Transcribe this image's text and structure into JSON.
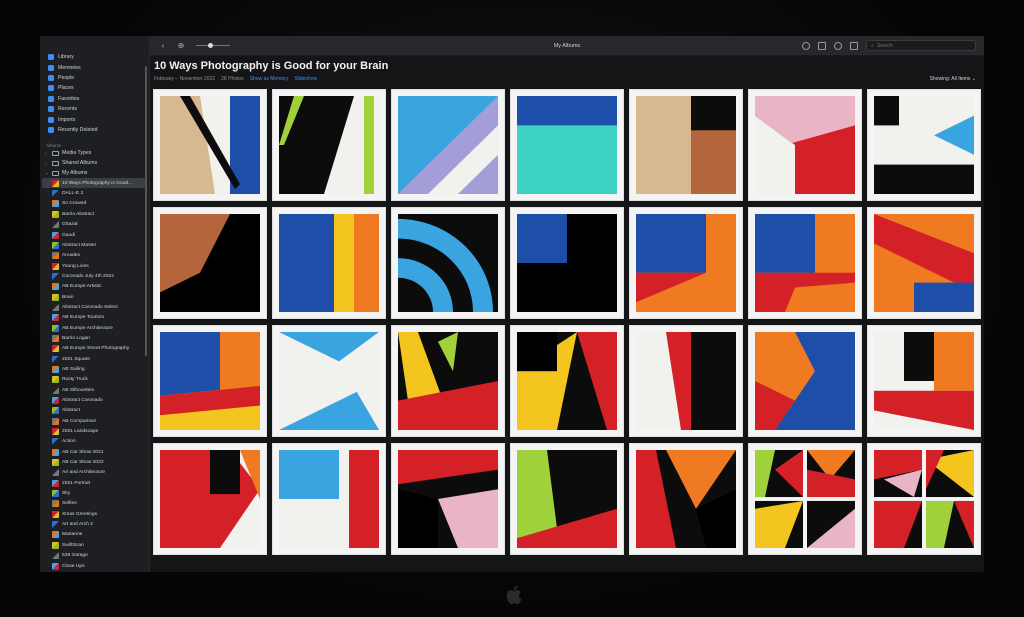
{
  "toolbar": {
    "window_title": "My Albums",
    "back_label": "‹",
    "search_placeholder": "Search"
  },
  "sidebar": {
    "library_items": [
      {
        "label": "Library",
        "icon": "photo-library-icon"
      },
      {
        "label": "Memories",
        "icon": "memories-icon"
      },
      {
        "label": "People",
        "icon": "people-icon"
      },
      {
        "label": "Places",
        "icon": "places-icon"
      },
      {
        "label": "Favorites",
        "icon": "heart-icon"
      },
      {
        "label": "Recents",
        "icon": "clock-icon"
      },
      {
        "label": "Imports",
        "icon": "import-icon"
      },
      {
        "label": "Recently Deleted",
        "icon": "trash-icon"
      }
    ],
    "albums_section": "Albums",
    "folders": [
      {
        "label": "Media Types",
        "chevron": "›"
      },
      {
        "label": "Shared Albums",
        "chevron": "›"
      },
      {
        "label": "My Albums",
        "chevron": "⌄"
      }
    ],
    "albums": [
      "10 Ways Photography is Good...",
      "DALL-E 2",
      "So Crowed",
      "Barrio Abstract",
      "Ghazal",
      "Gaudi",
      "Abstract Master",
      "Arcades",
      "Young Lions",
      "Coronado July 4th 2022",
      "AB Europe Artistic",
      "Brain",
      "Abstract Coronado Select",
      "AB Europe Tourism",
      "AB Europe Architecture",
      "Barrio Logan",
      "AB Europe Street Photography",
      "2021 Square",
      "AB Sailing",
      "Rusty Truck",
      "AB Silhouettes",
      "Abstract Coronado",
      "Abstract",
      "AB Comparison",
      "2021 Landscape",
      "Action",
      "AB Car Show 2021",
      "AB Car Show 2022",
      "Art and Architecture",
      "2021 Portrait",
      "Sky",
      "Selfies",
      "Xmas Greetings",
      "Art and Arch 2",
      "Marianne",
      "SwiftScan",
      "529 Garage",
      "Close Ups"
    ]
  },
  "album": {
    "title": "10 Ways Photography is Good for your Brain",
    "date_range": "February – November 2022",
    "count": "28 Photos",
    "show_memory": "Show as Memory",
    "slideshow": "Slideshow",
    "showing": "Showing: All Items ⌄"
  },
  "colors": {
    "accent": "#3b8ff2",
    "sidebar_bg": "#1d1f22",
    "content_bg": "#141517"
  }
}
